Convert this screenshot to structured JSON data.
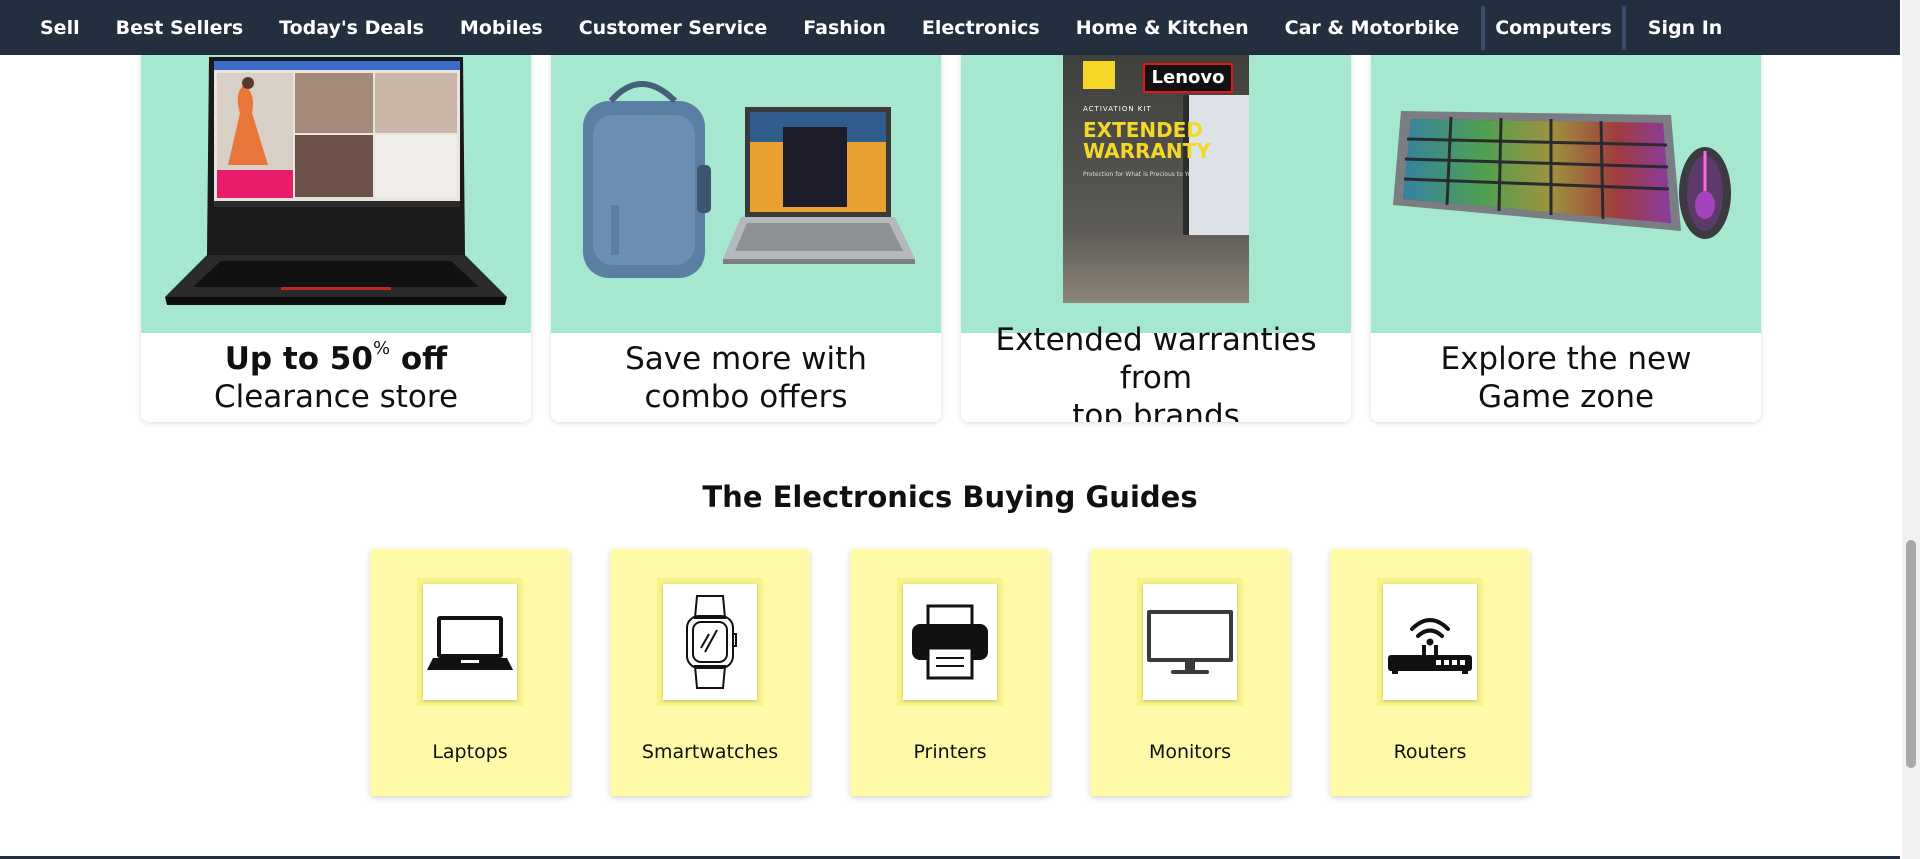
{
  "nav": {
    "items": [
      "Sell",
      "Best Sellers",
      "Today's Deals",
      "Mobiles",
      "Customer Service",
      "Fashion",
      "Electronics",
      "Home & Kitchen",
      "Car & Motorbike",
      "Computers",
      "Sign In"
    ]
  },
  "promos": [
    {
      "bold": "Up to 50",
      "sup": "%",
      "bold_after": " off",
      "line2": "Clearance store"
    },
    {
      "line1": "Save more with",
      "line2": "combo offers"
    },
    {
      "line1": "Extended warranties from",
      "line2": "top brands",
      "box_brand": "Lenovo",
      "box_kicker": "ACTIVATION KIT",
      "box_title1": "EXTENDED",
      "box_title2": "WARRANTY",
      "box_tagline": "Protection for What is Precious to You"
    },
    {
      "line1": "Explore the new",
      "line2": "Game zone"
    }
  ],
  "buying_guides": {
    "title": "The Electronics Buying Guides",
    "items": [
      {
        "label": "Laptops",
        "icon": "laptop-icon"
      },
      {
        "label": "Smartwatches",
        "icon": "smartwatch-icon"
      },
      {
        "label": "Printers",
        "icon": "printer-icon"
      },
      {
        "label": "Monitors",
        "icon": "monitor-icon"
      },
      {
        "label": "Routers",
        "icon": "router-icon"
      }
    ]
  },
  "colors": {
    "nav_bg": "#232f3e",
    "promo_bg": "#a6e7cf",
    "guide_bg": "#fffaa7"
  }
}
